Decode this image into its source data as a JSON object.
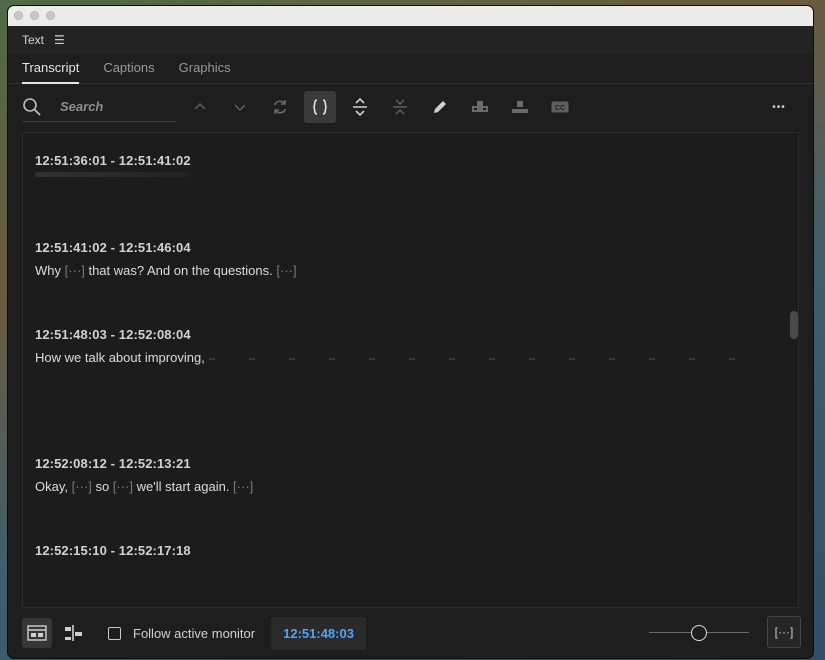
{
  "panel": {
    "title": "Text",
    "menu_glyph": "☰"
  },
  "tabs": [
    {
      "label": "Transcript",
      "active": true
    },
    {
      "label": "Captions",
      "active": false
    },
    {
      "label": "Graphics",
      "active": false
    }
  ],
  "toolbar": {
    "search_placeholder": "Search",
    "icons": [
      "search-icon",
      "chevron-up-icon",
      "chevron-down-icon",
      "refresh-icon",
      "split-segment-icon",
      "expand-icon",
      "collapse-icon",
      "pencil-icon",
      "speaker-icon",
      "insert-icon",
      "cc-icon",
      "more-icon"
    ],
    "more_glyph": "•••"
  },
  "segments": [
    {
      "timecode": "12:51:36:01 - 12:51:41:02",
      "text": ""
    },
    {
      "timecode": "12:51:41:02 - 12:51:46:04",
      "parts": [
        "Why ",
        "[···]",
        " that was? And on the questions. ",
        "[···]"
      ]
    },
    {
      "timecode": "12:51:48:03 - 12:52:08:04",
      "text": "How we talk about improving,"
    },
    {
      "timecode": "12:52:08:12 - 12:52:13:21",
      "parts": [
        "Okay, ",
        "[···]",
        " so ",
        "[···]",
        " we'll start again. ",
        "[···]"
      ]
    },
    {
      "timecode": "12:52:15:10 - 12:52:17:18",
      "text": ""
    }
  ],
  "footer": {
    "follow_label": "Follow active monitor",
    "timecode": "12:51:48:03",
    "ellipsis_label": "[···]",
    "zoom_level": 0.5
  },
  "colors": {
    "accent": "#4ea3ff",
    "background": "#1e1e1e"
  }
}
